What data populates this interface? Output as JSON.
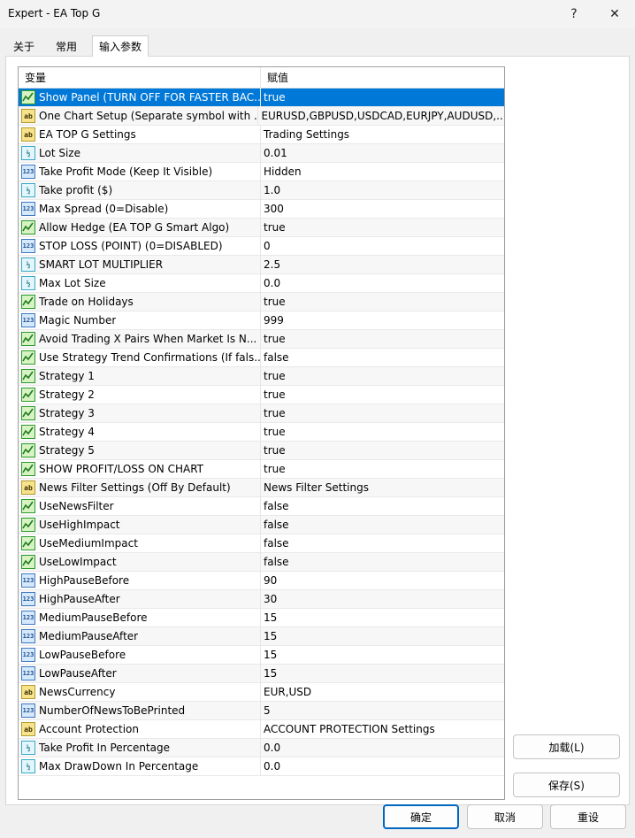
{
  "window": {
    "title": "Expert - EA Top G",
    "help_label": "?",
    "close_label": "✕"
  },
  "tabs": [
    {
      "label": "关于"
    },
    {
      "label": "常用"
    },
    {
      "label": "输入参数"
    }
  ],
  "grid": {
    "headers": {
      "variable": "变量",
      "value": "赋值"
    },
    "rows": [
      {
        "type": "bool",
        "name": "Show Panel (TURN OFF FOR FASTER BAC...",
        "value": "true"
      },
      {
        "type": "string",
        "name": "One Chart Setup (Separate symbol with ...",
        "value": "EURUSD,GBPUSD,USDCAD,EURJPY,AUDUSD,..."
      },
      {
        "type": "string",
        "name": "EA TOP G Settings",
        "value": "Trading Settings"
      },
      {
        "type": "double",
        "name": "Lot Size",
        "value": "0.01"
      },
      {
        "type": "int",
        "name": "Take Profit Mode (Keep It Visible)",
        "value": "Hidden"
      },
      {
        "type": "double",
        "name": "Take profit ($)",
        "value": "1.0"
      },
      {
        "type": "int",
        "name": "Max Spread (0=Disable)",
        "value": "300"
      },
      {
        "type": "bool",
        "name": "Allow Hedge (EA TOP G Smart Algo)",
        "value": "true"
      },
      {
        "type": "int",
        "name": "STOP LOSS (POINT) (0=DISABLED)",
        "value": "0"
      },
      {
        "type": "double",
        "name": "SMART LOT MULTIPLIER",
        "value": "2.5"
      },
      {
        "type": "double",
        "name": "Max Lot Size",
        "value": "0.0"
      },
      {
        "type": "bool",
        "name": "Trade on Holidays",
        "value": "true"
      },
      {
        "type": "int",
        "name": "Magic Number",
        "value": "999"
      },
      {
        "type": "bool",
        "name": "Avoid Trading X Pairs When Market Is N...",
        "value": "true"
      },
      {
        "type": "bool",
        "name": "Use Strategy Trend Confirmations (If fals...",
        "value": "false"
      },
      {
        "type": "bool",
        "name": "Strategy 1",
        "value": "true"
      },
      {
        "type": "bool",
        "name": "Strategy 2",
        "value": "true"
      },
      {
        "type": "bool",
        "name": "Strategy 3",
        "value": "true"
      },
      {
        "type": "bool",
        "name": "Strategy 4",
        "value": "true"
      },
      {
        "type": "bool",
        "name": "Strategy 5",
        "value": "true"
      },
      {
        "type": "bool",
        "name": "SHOW PROFIT/LOSS ON CHART",
        "value": "true"
      },
      {
        "type": "string",
        "name": "News Filter Settings (Off By Default)",
        "value": "News Filter Settings"
      },
      {
        "type": "bool",
        "name": "UseNewsFilter",
        "value": "false"
      },
      {
        "type": "bool",
        "name": "UseHighImpact",
        "value": "false"
      },
      {
        "type": "bool",
        "name": "UseMediumImpact",
        "value": "false"
      },
      {
        "type": "bool",
        "name": "UseLowImpact",
        "value": "false"
      },
      {
        "type": "int",
        "name": "HighPauseBefore",
        "value": "90"
      },
      {
        "type": "int",
        "name": "HighPauseAfter",
        "value": "30"
      },
      {
        "type": "int",
        "name": "MediumPauseBefore",
        "value": "15"
      },
      {
        "type": "int",
        "name": "MediumPauseAfter",
        "value": "15"
      },
      {
        "type": "int",
        "name": "LowPauseBefore",
        "value": "15"
      },
      {
        "type": "int",
        "name": "LowPauseAfter",
        "value": "15"
      },
      {
        "type": "string",
        "name": "NewsCurrency",
        "value": "EUR,USD"
      },
      {
        "type": "int",
        "name": "NumberOfNewsToBePrinted",
        "value": "5"
      },
      {
        "type": "string",
        "name": "Account Protection",
        "value": "ACCOUNT PROTECTION Settings"
      },
      {
        "type": "double",
        "name": "Take Profit In Percentage",
        "value": "0.0"
      },
      {
        "type": "double",
        "name": "Max DrawDown In Percentage",
        "value": "0.0"
      }
    ]
  },
  "icons": {
    "bool": "bool-param-icon",
    "string": "string-param-icon",
    "int": "int-param-icon",
    "double": "double-param-icon"
  },
  "icon_text": {
    "string": "ab",
    "int": "123",
    "double": "½"
  },
  "buttons": {
    "load": "加载(L)",
    "save": "保存(S)",
    "ok": "确定",
    "cancel": "取消",
    "reset": "重设"
  },
  "colors": {
    "selection": "#0078d7",
    "primary_border": "#0067c0"
  }
}
